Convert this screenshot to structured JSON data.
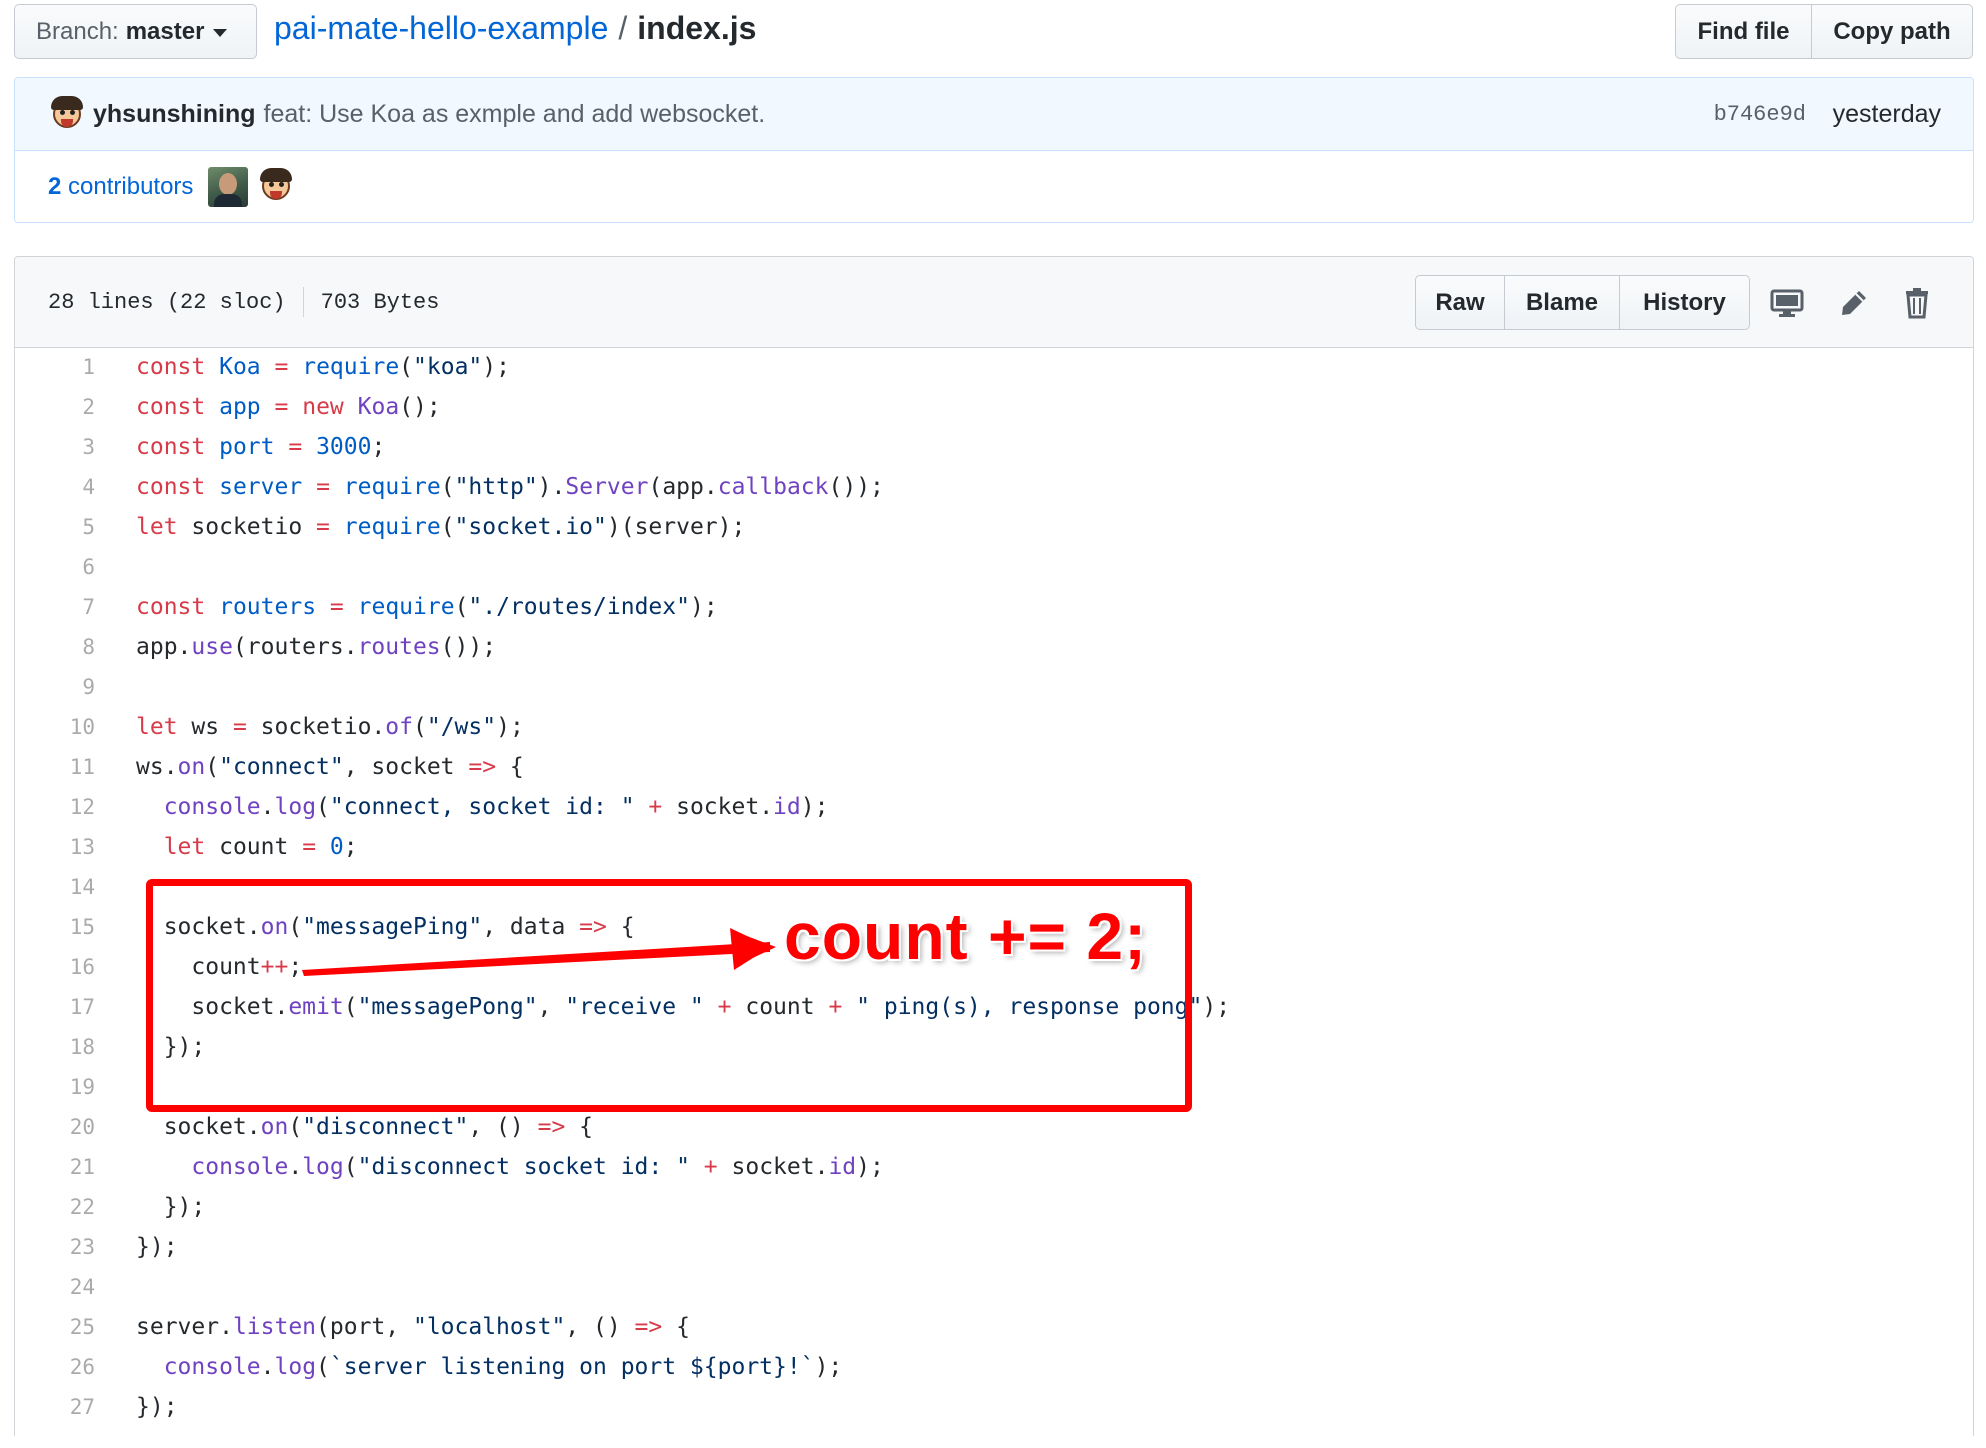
{
  "branch": {
    "label": "Branch:",
    "value": "master"
  },
  "breadcrumb": {
    "repo": "pai-mate-hello-example",
    "separator": "/",
    "file": "index.js"
  },
  "top_buttons": {
    "find_file": "Find file",
    "copy_path": "Copy path"
  },
  "commit": {
    "author": "yhsunshining",
    "message": "feat: Use Koa as exmple and add websocket.",
    "sha": "b746e9d",
    "time": "yesterday"
  },
  "contributors": {
    "count": "2",
    "label": "contributors"
  },
  "file_info": {
    "lines": "28 lines (22 sloc)",
    "size": "703 Bytes"
  },
  "file_buttons": {
    "raw": "Raw",
    "blame": "Blame",
    "history": "History"
  },
  "icons": [
    "desktop-icon",
    "pencil-icon",
    "trash-icon"
  ],
  "code_lines": [
    "const Koa = require(\"koa\");",
    "const app = new Koa();",
    "const port = 3000;",
    "const server = require(\"http\").Server(app.callback());",
    "let socketio = require(\"socket.io\")(server);",
    "",
    "const routers = require(\"./routes/index\");",
    "app.use(routers.routes());",
    "",
    "let ws = socketio.of(\"/ws\");",
    "ws.on(\"connect\", socket => {",
    "  console.log(\"connect, socket id: \" + socket.id);",
    "  let count = 0;",
    "",
    "  socket.on(\"messagePing\", data => {",
    "    count++;",
    "    socket.emit(\"messagePong\", \"receive \" + count + \" ping(s), response pong\");",
    "  });",
    "",
    "  socket.on(\"disconnect\", () => {",
    "    console.log(\"disconnect socket id: \" + socket.id);",
    "  });",
    "});",
    "",
    "server.listen(port, \"localhost\", () => {",
    "  console.log(`server listening on port ${port}!`);",
    "});"
  ],
  "annotation": {
    "text": "count += 2;",
    "color": "#ff0000"
  },
  "colors": {
    "link": "#0366d6",
    "keyword": "#d73a49",
    "entity": "#005cc5",
    "function": "#6f42c1",
    "string": "#032f62"
  }
}
